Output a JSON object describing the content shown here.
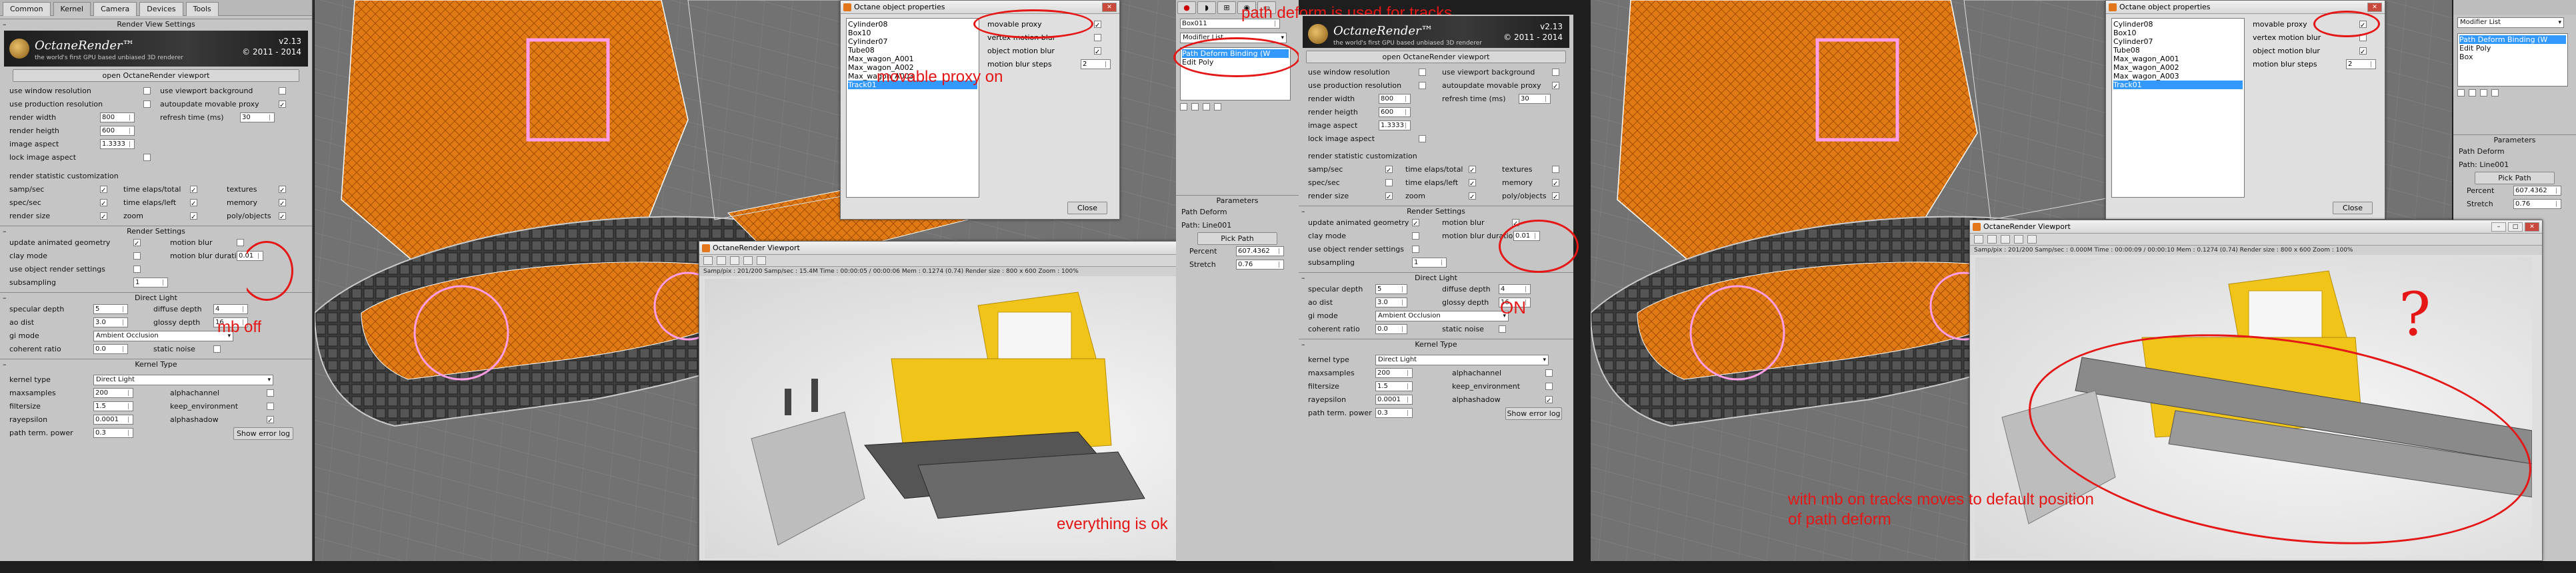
{
  "tabs": [
    "Common",
    "Kernel",
    "Camera",
    "Devices",
    "Tools"
  ],
  "render_view_settings": {
    "header": "Render View Settings",
    "logo_name": "OctaneRender™",
    "logo_sub": "the world's first GPU based unbiased 3D renderer",
    "logo_ver1": "v2.13",
    "logo_ver2": "© 2011 - 2014",
    "open_viewport": "open OctaneRender viewport",
    "use_window_resolution": "use window resolution",
    "use_viewport_background": "use viewport background",
    "use_production_resolution": "use production resolution",
    "autoupdate_movable_proxy": "autoupdate movable proxy",
    "render_width": "render width",
    "render_width_val": "800",
    "render_height": "render heigth",
    "render_height_val": "600",
    "image_aspect": "image aspect",
    "image_aspect_val": "1.3333",
    "refresh_time": "refresh time (ms)",
    "refresh_time_val": "30",
    "lock_image_aspect": "lock image aspect",
    "stat_title": "render statistic customization",
    "samp_sec": "samp/sec",
    "time_elaps_total": "time elaps/total",
    "textures": "textures",
    "spec_sec": "spec/sec",
    "time_elaps_left": "time elaps/left",
    "memory": "memory",
    "render_size": "render size",
    "zoom": "zoom",
    "polyobjects": "poly/objects"
  },
  "render_settings": {
    "header": "Render Settings",
    "update_animated_geometry": "update animated geometry",
    "motion_blur": "motion blur",
    "clay_mode": "clay mode",
    "motion_blur_duration": "motion blur duration",
    "motion_blur_duration_val": "0.01",
    "use_object_render_settings": "use object render settings",
    "subsampling": "subsampling",
    "subsampling_val": "1"
  },
  "direct_light": {
    "header": "Direct Light",
    "specular_depth": "specular depth",
    "specular_depth_val": "5",
    "diffuse_depth": "diffuse depth",
    "diffuse_depth_val": "4",
    "ao_dist": "ao dist",
    "ao_dist_val": "3.0",
    "glossy_depth": "glossy depth",
    "glossy_depth_val": "16",
    "gi_mode": "gi mode",
    "gi_mode_val": "Ambient Occlusion",
    "coherent_ratio": "coherent ratio",
    "coherent_ratio_val": "0.0",
    "static_noise": "static noise"
  },
  "kernel_type": {
    "header": "Kernel Type",
    "kernel_type": "kernel type",
    "kernel_type_val": "Direct Light",
    "maxsamples": "maxsamples",
    "maxsamples_val": "200",
    "alphachannel": "alphachannel",
    "filtersize": "filtersize",
    "filtersize_val": "1.5",
    "keep_environment": "keep_environment",
    "rayepsilon": "rayepsilon",
    "rayepsilon_val": "0.0001",
    "alphashadow": "alphashadow",
    "path_term_power": "path term. power",
    "path_term_power_val": "0.3",
    "show_error_log": "Show error log"
  },
  "object_props": {
    "title": "Octane object properties",
    "items": [
      "Cylinder08",
      "Box10",
      "Cylinder07",
      "Tube08",
      "Max_wagon_A001",
      "Max_wagon_A002",
      "Max_wagon_A003",
      "Track01"
    ],
    "movable_proxy": "movable proxy",
    "vertex_motion_blur": "vertex motion blur",
    "object_motion_blur": "object motion blur",
    "motion_blur_steps": "motion blur steps",
    "motion_blur_steps_val": "2",
    "close": "Close"
  },
  "modifier": {
    "object_name": "Box011",
    "modifier_list": "Modifier List",
    "stack": [
      "Path Deform Binding (W",
      "Edit Poly"
    ],
    "stack_right": [
      "Path Deform Binding (W",
      "Edit Poly",
      "Box"
    ],
    "parameters": "Parameters",
    "path_deform": "Path Deform",
    "path_label": "Path: Line001",
    "pick_path": "Pick Path",
    "percent": "Percent",
    "percent_val": "607.4362",
    "stretch": "Stretch",
    "stretch_val": "0.76"
  },
  "viewport_window": {
    "title": "OctaneRender Viewport",
    "status": "Samp/pix : 201/200    Samp/sec : 15.4M    Time : 00:00:05 / 00:00:06    Mem : 0.1274 (0.74)    Render size : 800 x 600    Zoom : 100%",
    "status_right": "Samp/pix : 201/200    Samp/sec : 0.000M    Time : 00:00:09 / 00:00:10    Mem : 0.1274 (0.74)    Render size : 800 x 600    Zoom : 100%"
  },
  "annotations": {
    "mb_off": "mb off",
    "movable_proxy_on": "movable proxy on",
    "everything_ok": "everything is ok",
    "path_deform_tracks": "path deform is used for tracks",
    "on": "ON",
    "question": "?",
    "tracks_default_1": "with mb on  tracks moves to default position",
    "tracks_default_2": "of  path deform"
  },
  "colors": {
    "annotation_red": "#e41616",
    "panel_gray": "#c5c5c5",
    "truck_yellow": "#f0c419",
    "wire_orange": "#e07a14"
  }
}
